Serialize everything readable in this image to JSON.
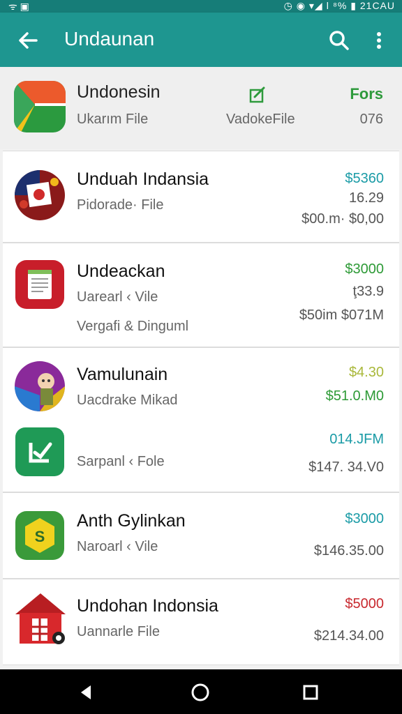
{
  "status_bar": {
    "left_icons": "ᯤ ▣",
    "right_text": "◷ ◉ ▾◢ ǀ ⁸% ▮ 21CAU"
  },
  "app_bar": {
    "title": "Undaunan"
  },
  "top_item": {
    "name": "Undonesin",
    "sub": "Ukarım File",
    "mid": "VadokeFile",
    "right_top": "Fors",
    "right_bottom": "076"
  },
  "rows": [
    {
      "name": "Unduah Indansia",
      "sub": "Pidorade· File",
      "price": "$5360",
      "value": "16.29",
      "extra": "$00.m· $0,00"
    },
    {
      "name": "Undeackan",
      "sub": "Uarearl ‹ Vile",
      "sub2": "Vergafi & Dinguml",
      "price": "$3000",
      "value": "ţ33.9",
      "extra": "$50im  $071M"
    },
    {
      "name": "Vamulunain",
      "sub": "Uacdrake Mikad",
      "price": "$4.30",
      "value": "$51.0.M0",
      "sub_b": "Sarpanl ‹ Fole",
      "value_b": "014.JFM",
      "extra_b": "$147.  34.V0"
    },
    {
      "name": "Anth Gylinkan",
      "sub": "Naroarl ‹ Vile",
      "price": "$3000",
      "extra": "$146.35.00"
    },
    {
      "name": "Undohan Indonsia",
      "sub": "Uannarle File",
      "price": "$5000",
      "extra": "$214.34.00"
    }
  ]
}
